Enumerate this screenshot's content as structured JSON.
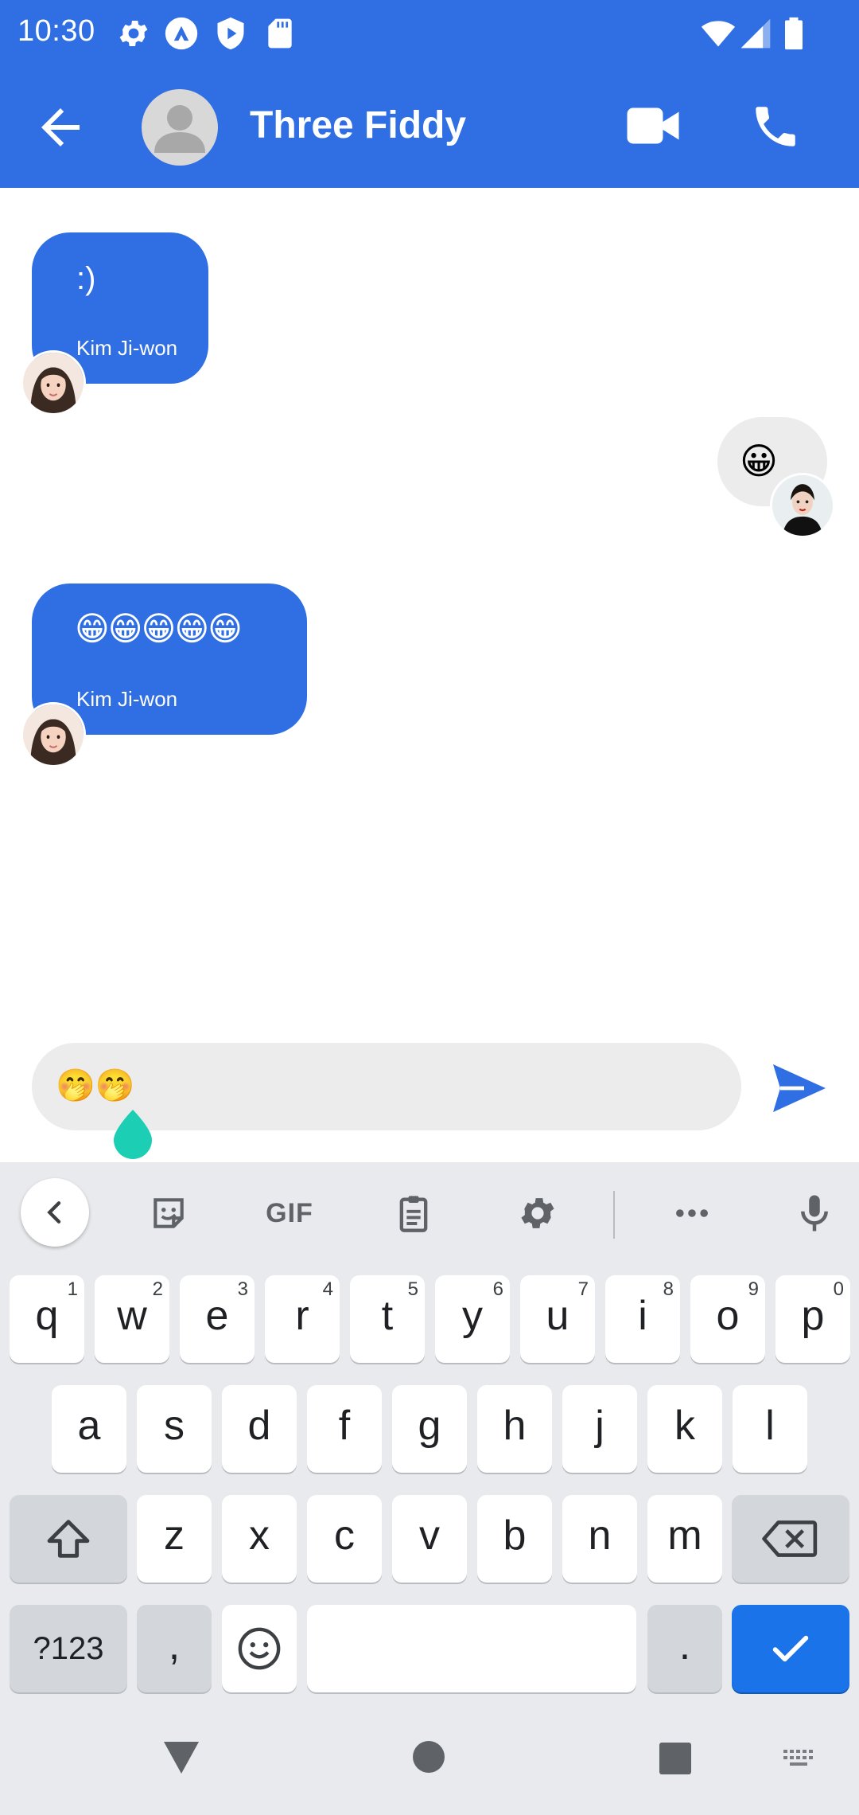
{
  "status_bar": {
    "time": "10:30",
    "left_icons": [
      "settings-icon",
      "app-notification-icon",
      "shield-icon",
      "sd-card-icon"
    ],
    "right_icons": [
      "wifi-icon",
      "signal-icon",
      "battery-icon"
    ]
  },
  "app_bar": {
    "contact_name": "Three Fiddy",
    "back_icon": "arrow-back-icon",
    "video_icon": "videocam-icon",
    "call_icon": "phone-icon",
    "color": "#2f6ee3"
  },
  "messages": [
    {
      "direction": "incoming",
      "text": ":)",
      "sender": "Kim Ji-won"
    },
    {
      "direction": "outgoing",
      "text": "😀"
    },
    {
      "direction": "incoming",
      "text": "😁😁😁😁😁",
      "sender": "Kim Ji-won"
    }
  ],
  "composer": {
    "value": "🤭🤭",
    "send_icon": "send-icon"
  },
  "keyboard": {
    "toolbar": {
      "collapse_icon": "chevron-left-icon",
      "sticker_icon": "sticker-icon",
      "gif_label": "GIF",
      "clipboard_icon": "clipboard-icon",
      "settings_icon": "gear-icon",
      "more_icon": "more-horiz-icon",
      "mic_icon": "mic-icon"
    },
    "row1": [
      {
        "key": "q",
        "hint": "1"
      },
      {
        "key": "w",
        "hint": "2"
      },
      {
        "key": "e",
        "hint": "3"
      },
      {
        "key": "r",
        "hint": "4"
      },
      {
        "key": "t",
        "hint": "5"
      },
      {
        "key": "y",
        "hint": "6"
      },
      {
        "key": "u",
        "hint": "7"
      },
      {
        "key": "i",
        "hint": "8"
      },
      {
        "key": "o",
        "hint": "9"
      },
      {
        "key": "p",
        "hint": "0"
      }
    ],
    "row2": [
      "a",
      "s",
      "d",
      "f",
      "g",
      "h",
      "j",
      "k",
      "l"
    ],
    "row3": [
      "z",
      "x",
      "c",
      "v",
      "b",
      "n",
      "m"
    ],
    "symbols_label": "?123",
    "comma_label": ",",
    "period_label": ".",
    "shift_icon": "shift-icon",
    "backspace_icon": "backspace-icon",
    "emoji_icon": "emoji-icon",
    "enter_icon": "check-icon",
    "accent_color": "#1a73e8"
  },
  "nav_bar": {
    "back_icon": "nav-back-triangle-icon",
    "home_icon": "nav-home-circle-icon",
    "recents_icon": "nav-recents-square-icon",
    "keyboard_switch_icon": "keyboard-icon"
  }
}
